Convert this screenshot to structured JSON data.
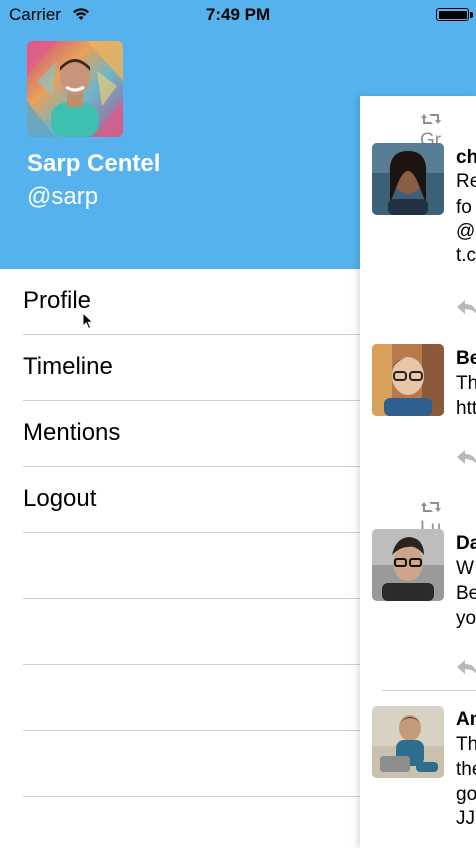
{
  "status_bar": {
    "carrier": "Carrier",
    "time": "7:49 PM",
    "battery_level": 1.0
  },
  "profile": {
    "name": "Sarp Centel",
    "handle": "@sarp"
  },
  "menu": {
    "items": [
      {
        "label": "Profile"
      },
      {
        "label": "Timeline"
      },
      {
        "label": "Mentions"
      },
      {
        "label": "Logout"
      },
      {
        "label": ""
      },
      {
        "label": ""
      },
      {
        "label": ""
      },
      {
        "label": ""
      }
    ]
  },
  "timeline": {
    "tweets": [
      {
        "retweet_by": "Gr",
        "author": "ch",
        "lines": [
          "Re",
          "fo",
          "@l",
          "t.c"
        ]
      },
      {
        "retweet_by": "",
        "author": "Be",
        "lines": [
          "Th",
          "htt"
        ]
      },
      {
        "retweet_by": "Lu",
        "author": "Da",
        "lines": [
          "W",
          "Be",
          "yo"
        ]
      },
      {
        "retweet_by": "",
        "author": "An",
        "lines": [
          "Th",
          "the",
          "go",
          "JJ"
        ]
      }
    ]
  },
  "colors": {
    "header_blue": "#55b2ed",
    "divider": "#cfcfcf",
    "icon_gray": "#8e8e93"
  },
  "icons": [
    "wifi-icon",
    "battery-icon",
    "retweet-icon",
    "reply-icon",
    "cursor-icon"
  ]
}
